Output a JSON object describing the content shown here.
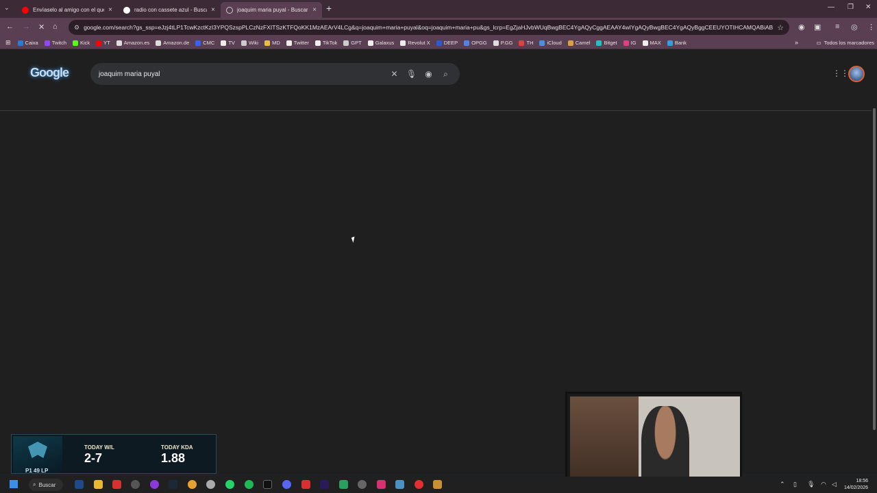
{
  "browser": {
    "tabs": [
      {
        "title": "Envíaselo al amigo con el que c...",
        "favicon": "youtube",
        "active": false
      },
      {
        "title": "radio con cassete azul - Buscar",
        "favicon": "google",
        "active": false
      },
      {
        "title": "joaquim maria puyal - Buscar c...",
        "favicon": "loading",
        "active": true
      }
    ],
    "url": "google.com/search?gs_ssp=eJzj4tLP1TcwKzctKzI3YPQSzspPLCzNzFXITSzKTFQoKK1MzAEArV4LCg&q=joaquim+maria+puyal&oq=joaquim+maria+pu&gs_lcrp=EgZjaHJvbWUqBwgBEC4YgAQyCggAEAAY4wIYgAQyBwgBEC4YgAQyBggCEEUYOTIHCAMQABiABD...",
    "bookmarks": [
      "Caixa",
      "Twitch",
      "Kick",
      "YT",
      "Amazon.es",
      "Amazon.de",
      "CMC",
      "TV",
      "Wiki",
      "MD",
      "Twitter",
      "TikTok",
      "GPT",
      "Galaxus",
      "Revolut X",
      "DEEP",
      "OPGG",
      "P.GG",
      "TH",
      "iCloud",
      "Camel",
      "Bitget",
      "IG",
      "MAX",
      "Bank"
    ],
    "all_bookmarks": "Todos los marcadores"
  },
  "google": {
    "logo": "Google",
    "query": "joaquim maria puyal"
  },
  "overlay": {
    "rank": "P1 49 LP",
    "wl_label": "TODAY W/L",
    "wl_value": "2-7",
    "kda_label": "TODAY KDA",
    "kda_value": "1.88"
  },
  "taskbar": {
    "search_label": "Buscar",
    "time": "18:56",
    "date": "14/02/2026"
  }
}
